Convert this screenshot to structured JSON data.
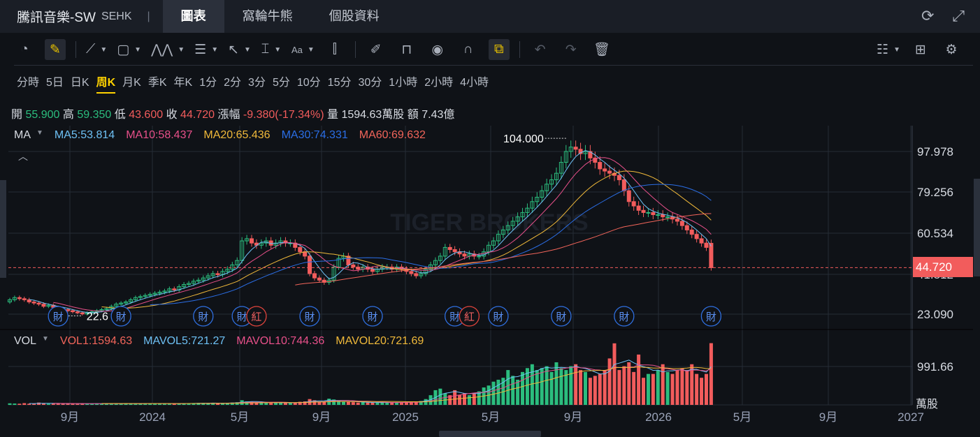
{
  "header": {
    "title": "騰訊音樂-SW",
    "exchange": "SEHK",
    "tabs": [
      "圖表",
      "窩輪牛熊",
      "個股資料"
    ],
    "active_tab": 0
  },
  "toolbar": {
    "left_icons": [
      "gauge-icon",
      "pencil-icon",
      "line-icon",
      "rectangle-icon",
      "pattern-icon",
      "fib-icon",
      "arrow-icon",
      "price-range-icon",
      "text-icon",
      "candle-icon",
      "brush-icon",
      "lock-icon",
      "eye-icon",
      "magnet-icon",
      "link-icon",
      "undo-icon",
      "redo-icon",
      "trash-icon"
    ],
    "right_icons": [
      "list-icon",
      "layout-icon",
      "gear-icon"
    ]
  },
  "periods": [
    "分時",
    "5日",
    "日K",
    "周K",
    "月K",
    "季K",
    "年K",
    "1分",
    "2分",
    "3分",
    "5分",
    "10分",
    "15分",
    "30分",
    "1小時",
    "2小時",
    "4小時"
  ],
  "active_period": 3,
  "quote": {
    "open_label": "開",
    "open": "55.900",
    "high_label": "高",
    "high": "59.350",
    "low_label": "低",
    "low": "43.600",
    "close_label": "收",
    "close": "44.720",
    "chg_label": "漲幅",
    "chg": "-9.380(-17.34%)",
    "vol_label": "量",
    "vol": "1594.63萬股",
    "amt_label": "額",
    "amt": "7.43億"
  },
  "ma_legend": {
    "name": "MA",
    "items": [
      {
        "text": "MA5:53.814",
        "color": "#6ec1f5"
      },
      {
        "text": "MA10:58.437",
        "color": "#e8508a"
      },
      {
        "text": "MA20:65.436",
        "color": "#f0b93a"
      },
      {
        "text": "MA30:74.331",
        "color": "#2b6ee6"
      },
      {
        "text": "MA60:69.632",
        "color": "#f2655a"
      }
    ]
  },
  "vol_legend": {
    "name": "VOL",
    "items": [
      {
        "text": "VOL1:1594.63",
        "color": "#f2655a"
      },
      {
        "text": "MAVOL5:721.27",
        "color": "#6ec1f5"
      },
      {
        "text": "MAVOL10:744.36",
        "color": "#e8508a"
      },
      {
        "text": "MAVOL20:721.69",
        "color": "#f0b93a"
      }
    ]
  },
  "price_axis": [
    "97.978",
    "79.256",
    "60.534",
    "41.812",
    "23.090"
  ],
  "last_price": "44.720",
  "vol_axis": [
    "991.66",
    "萬股"
  ],
  "x_axis": [
    "9月",
    "2024",
    "5月",
    "9月",
    "2025",
    "5月",
    "9月",
    "2026",
    "5月",
    "9月",
    "2027"
  ],
  "watermark": "TIGER BROKERS",
  "chart_data": {
    "type": "candlestick",
    "price_ticks": [
      97.978,
      79.256,
      60.534,
      41.812,
      23.09
    ],
    "closes": [
      30,
      31,
      30.5,
      30,
      29,
      28.5,
      28,
      27,
      27.5,
      26.5,
      26,
      25.5,
      25,
      24.5,
      24,
      23.5,
      24,
      24.5,
      25,
      25.5,
      26,
      27,
      28,
      28.5,
      29,
      30,
      31,
      31.5,
      32,
      32.5,
      33,
      33.5,
      34,
      35,
      34.5,
      36,
      37,
      37.5,
      38.5,
      39,
      40,
      41,
      42,
      41.5,
      43,
      44,
      46,
      48,
      57,
      58,
      56,
      55,
      56,
      57,
      55,
      56,
      57,
      56,
      56,
      54,
      52,
      50,
      42,
      40,
      39,
      38,
      39,
      45,
      49,
      50,
      46,
      45,
      44,
      45,
      44,
      43,
      44,
      45,
      45,
      44,
      45,
      44,
      43,
      42,
      41,
      42,
      44,
      46,
      48,
      50,
      54,
      53,
      52,
      51,
      50,
      51,
      50,
      50,
      52,
      55,
      57,
      60,
      62,
      64,
      66,
      68,
      70,
      72,
      75,
      77,
      80,
      83,
      85,
      88,
      93,
      98,
      100,
      99,
      97,
      98,
      95,
      93,
      90,
      89,
      88,
      87,
      85,
      80,
      75,
      73,
      71,
      70,
      70,
      69,
      69,
      68,
      68,
      67,
      66,
      64,
      62,
      60,
      58,
      56,
      54,
      44.72
    ],
    "first_open": 29,
    "last_open": 55.9,
    "volumes": [
      40,
      35,
      30,
      45,
      30,
      35,
      60,
      40,
      30,
      35,
      30,
      40,
      35,
      30,
      25,
      30,
      35,
      30,
      40,
      30,
      35,
      40,
      30,
      35,
      40,
      30,
      35,
      30,
      40,
      45,
      30,
      35,
      30,
      40,
      35,
      30,
      35,
      40,
      45,
      50,
      45,
      40,
      50,
      40,
      45,
      50,
      60,
      70,
      120,
      90,
      80,
      60,
      55,
      60,
      50,
      55,
      60,
      50,
      55,
      60,
      80,
      90,
      150,
      120,
      80,
      90,
      160,
      140,
      110,
      90,
      80,
      70,
      60,
      70,
      60,
      55,
      60,
      70,
      60,
      55,
      60,
      70,
      80,
      90,
      80,
      100,
      150,
      250,
      380,
      420,
      300,
      250,
      380,
      260,
      300,
      250,
      300,
      350,
      450,
      500,
      600,
      650,
      700,
      900,
      750,
      650,
      850,
      950,
      1050,
      900,
      950,
      1000,
      850,
      1100,
      950,
      900,
      1000,
      1050,
      900,
      850,
      700,
      750,
      800,
      900,
      1200,
      1590,
      900,
      1000,
      1100,
      850,
      1300,
      700,
      800,
      800,
      900,
      1050,
      850,
      800,
      900,
      950,
      900,
      1050,
      800,
      700,
      800,
      1594.63
    ],
    "vol_tick": 991.66,
    "high_note": "104.000",
    "high_index": 115,
    "low_note": "22.6",
    "low_index": 15,
    "events": [
      {
        "label": "財",
        "index": 10
      },
      {
        "label": "財",
        "index": 23
      },
      {
        "label": "財",
        "index": 40
      },
      {
        "label": "財",
        "index": 48
      },
      {
        "label": "紅",
        "index": 51
      },
      {
        "label": "財",
        "index": 62
      },
      {
        "label": "財",
        "index": 75
      },
      {
        "label": "財",
        "index": 92
      },
      {
        "label": "紅",
        "index": 95
      },
      {
        "label": "財",
        "index": 101
      },
      {
        "label": "財",
        "index": 114
      },
      {
        "label": "財",
        "index": 127
      },
      {
        "label": "財",
        "index": 145
      }
    ],
    "ma_periods": [
      5,
      10,
      20,
      30,
      60
    ],
    "ma_colors": [
      "#6ec1f5",
      "#e8508a",
      "#f0b93a",
      "#2b6ee6",
      "#f2655a"
    ],
    "up_color": "#2bbd7e",
    "down_color": "#f25c5c"
  }
}
